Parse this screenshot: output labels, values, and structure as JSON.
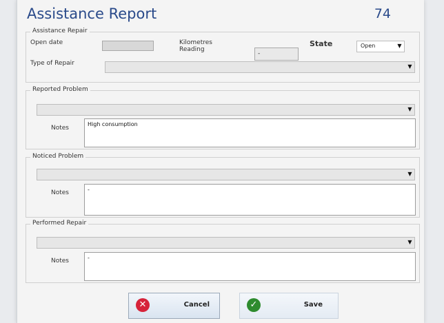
{
  "header": {
    "title": "Assistance Report",
    "report_number": "74"
  },
  "repair": {
    "legend": "Assistance Repair",
    "open_date_label": "Open date",
    "open_date_value": "",
    "km_label_line1": "Kilometres",
    "km_label_line2": "Reading",
    "km_value": "-",
    "state_label": "State",
    "state_value": "Open",
    "type_label": "Type of Repair",
    "type_value": ""
  },
  "reported": {
    "legend": "Reported Problem",
    "select_value": "",
    "notes_label": "Notes",
    "notes_value": "High consumption"
  },
  "noticed": {
    "legend": "Noticed Problem",
    "select_value": "",
    "notes_label": "Notes",
    "notes_value": "-"
  },
  "performed": {
    "legend": "Performed Repair",
    "select_value": "",
    "notes_label": "Notes",
    "notes_value": "-"
  },
  "buttons": {
    "cancel_label": "Cancel",
    "save_label": "Save"
  },
  "icons": {
    "dropdown": "chevron-down-icon",
    "cancel": "x-circle-icon",
    "save": "check-circle-icon"
  },
  "colors": {
    "title": "#2a4a8a",
    "cancel_icon": "#d6233a",
    "save_icon": "#2e8b2e"
  }
}
